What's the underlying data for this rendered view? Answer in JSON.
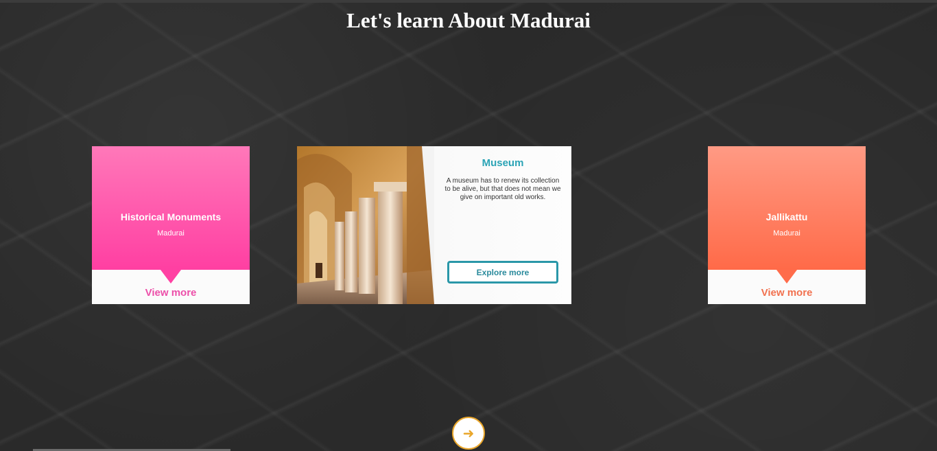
{
  "page": {
    "title": "Let's learn About Madurai"
  },
  "cards": {
    "left": {
      "title": "Historical Monuments",
      "subtitle": "Madurai",
      "link": "View more",
      "gradient": [
        "#ff78b9",
        "#ff3fa2"
      ],
      "link_color": "#ec4fa9"
    },
    "center": {
      "title": "Museum",
      "description": "A museum has to renew its collection to be alive, but that does not mean we give on important old works.",
      "button": "Explore more",
      "accent": "#2aa3b5"
    },
    "right": {
      "title": "Jallikattu",
      "subtitle": "Madurai",
      "link": "View more",
      "gradient": [
        "#ff9a84",
        "#ff6a48"
      ],
      "link_color": "#f1714f"
    }
  },
  "navigation": {
    "next_icon": "arrow-right-icon",
    "next_glyph": "➜",
    "accent": "#e9a62a"
  }
}
